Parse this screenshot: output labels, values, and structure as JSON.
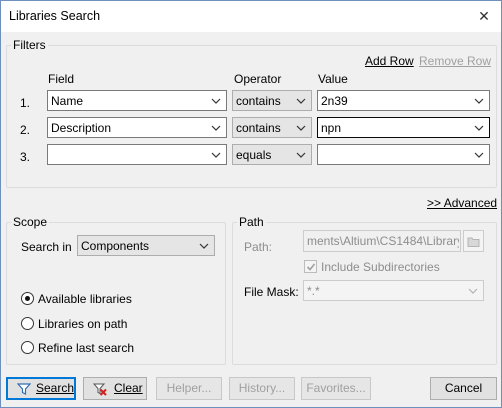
{
  "window": {
    "title": "Libraries Search",
    "close_glyph": "✕"
  },
  "filters": {
    "group_label": "Filters",
    "add_row": "Add Row",
    "remove_row": "Remove Row",
    "headers": {
      "field": "Field",
      "operator": "Operator",
      "value": "Value"
    },
    "rows": [
      {
        "num": "1.",
        "field": "Name",
        "operator": "contains",
        "value": "2n39"
      },
      {
        "num": "2.",
        "field": "Description",
        "operator": "contains",
        "value": "npn"
      },
      {
        "num": "3.",
        "field": "",
        "operator": "equals",
        "value": ""
      }
    ],
    "advanced": ">> Advanced"
  },
  "scope": {
    "group_label": "Scope",
    "search_in_label": "Search in",
    "search_in_value": "Components",
    "options": [
      "Available libraries",
      "Libraries on path",
      "Refine last search"
    ],
    "selected_index": 0
  },
  "path": {
    "group_label": "Path",
    "path_label": "Path:",
    "path_value": "ments\\Altium\\CS1484\\Library\\",
    "include_subdirs_label": "Include Subdirectories",
    "include_subdirs_checked": true,
    "file_mask_label": "File Mask:",
    "file_mask_value": "*.*"
  },
  "buttons": {
    "search": "Search",
    "clear": "Clear",
    "helper": "Helper...",
    "history": "History...",
    "favorites": "Favorites...",
    "cancel": "Cancel"
  }
}
